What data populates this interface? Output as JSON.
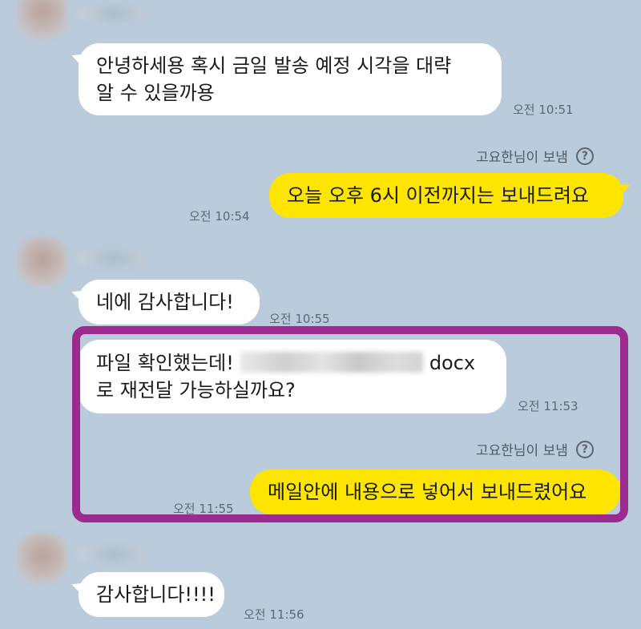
{
  "theme": {
    "background": "#bacbdb",
    "incoming_bubble": "#ffffff",
    "outgoing_bubble": "#fee500",
    "highlight_border": "#9b2b8e"
  },
  "messages": [
    {
      "direction": "incoming",
      "lines": [
        "안녕하세용 혹시 금일 발송 예정 시각을 대략",
        "알 수 있을까용"
      ],
      "time": "오전 10:51"
    },
    {
      "direction": "outgoing",
      "read_receipt": "고요한님이 보냄",
      "lines": [
        "오늘 오후 6시 이전까지는 보내드려요"
      ],
      "time": "오전 10:54"
    },
    {
      "direction": "incoming",
      "lines": [
        "네에 감사합니다!"
      ],
      "time": "오전 10:55"
    },
    {
      "direction": "incoming",
      "lines": [
        "파일 확인했는데!",
        "docx",
        "로 재전달 가능하실까요?"
      ],
      "time": "오전 11:53"
    },
    {
      "direction": "outgoing",
      "read_receipt": "고요한님이 보냄",
      "lines": [
        "메일안에 내용으로 넣어서 보내드렸어요"
      ],
      "time": "오전 11:55"
    },
    {
      "direction": "incoming",
      "lines": [
        "감사합니다!!!!"
      ],
      "time": "오전 11:56"
    }
  ],
  "icons": {
    "help": "?"
  }
}
